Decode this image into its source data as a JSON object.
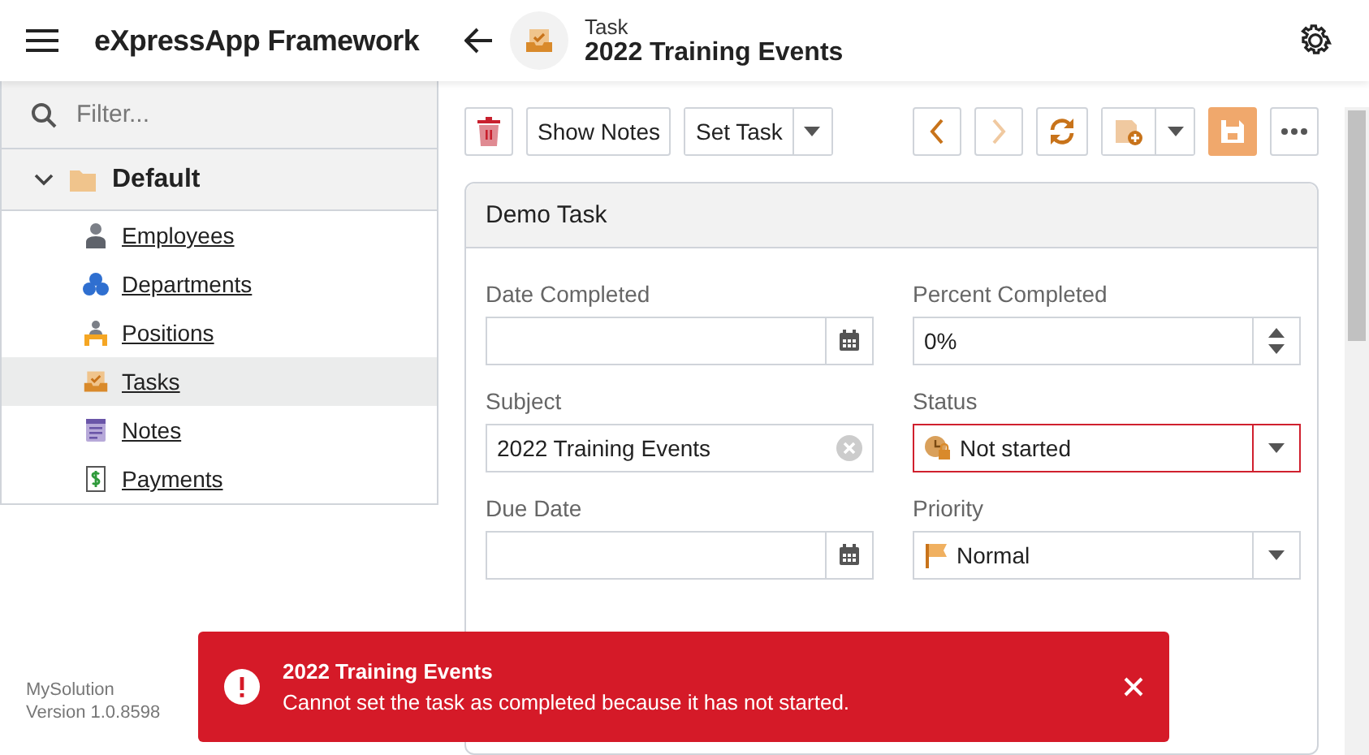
{
  "app": {
    "title": "eXpressApp Framework"
  },
  "header": {
    "object_type": "Task",
    "object_title": "2022 Training Events"
  },
  "sidebar": {
    "filter": {
      "placeholder": "Filter..."
    },
    "group": {
      "label": "Default",
      "expanded": true,
      "children": [
        {
          "label": "Employees",
          "kind": "employee",
          "selected": false
        },
        {
          "label": "Departments",
          "kind": "department",
          "selected": false
        },
        {
          "label": "Positions",
          "kind": "position",
          "selected": false
        },
        {
          "label": "Tasks",
          "kind": "task",
          "selected": true
        },
        {
          "label": "Notes",
          "kind": "note",
          "selected": false
        },
        {
          "label": "Payments",
          "kind": "payment",
          "selected": false
        }
      ]
    },
    "footer": [
      "MySolution",
      "Version 1.0.8598"
    ]
  },
  "toolbar": {
    "left": [
      {
        "kind": "delete"
      },
      {
        "kind": "text",
        "label": "Show Notes"
      },
      {
        "kind": "split",
        "label": "Set Task"
      }
    ],
    "right": [
      {
        "kind": "previous",
        "disabled": false
      },
      {
        "kind": "next",
        "disabled": true
      },
      {
        "kind": "refresh",
        "disabled": false
      },
      {
        "kind": "new"
      },
      {
        "kind": "save"
      },
      {
        "kind": "more"
      }
    ]
  },
  "card": {
    "title": "Demo Task",
    "fields": [
      {
        "label": "Date Completed",
        "kind": "date",
        "invalid": false
      },
      {
        "label": "Percent Completed",
        "kind": "spin",
        "value": "0%",
        "invalid": false
      },
      {
        "label": "Subject",
        "kind": "text",
        "value": "2022 Training Events",
        "invalid": false
      },
      {
        "label": "Status",
        "kind": "status",
        "value": "Not started",
        "invalid": true
      },
      {
        "label": "Due Date",
        "kind": "date",
        "invalid": false
      },
      {
        "label": "Priority",
        "kind": "priority",
        "value": "Normal",
        "invalid": false
      }
    ]
  },
  "toast": {
    "title": "2022 Training Events",
    "message": "Cannot set the task as completed because it has not started."
  }
}
